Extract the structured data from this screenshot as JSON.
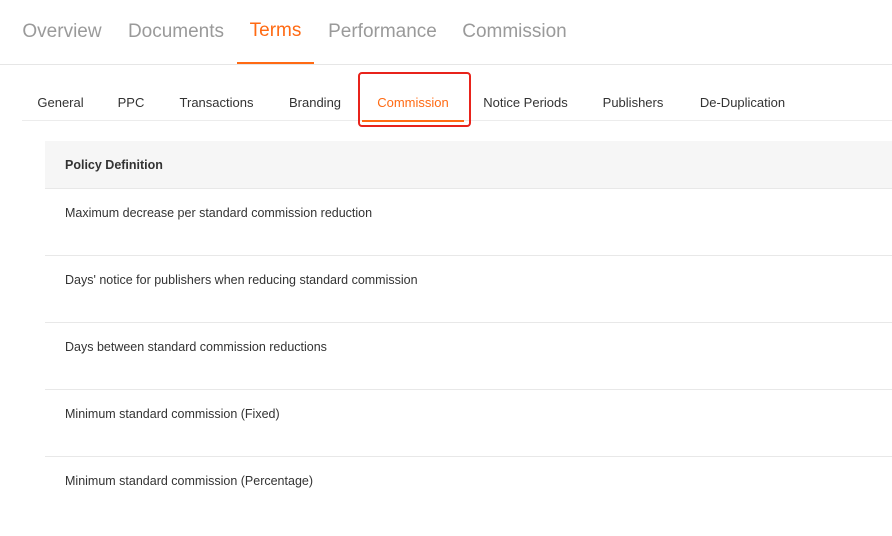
{
  "primary_tabs": [
    {
      "label": "Overview"
    },
    {
      "label": "Documents"
    },
    {
      "label": "Terms"
    },
    {
      "label": "Performance"
    },
    {
      "label": "Commission"
    }
  ],
  "primary_active": "Terms",
  "secondary_tabs": [
    {
      "label": "General"
    },
    {
      "label": "PPC"
    },
    {
      "label": "Transactions"
    },
    {
      "label": "Branding"
    },
    {
      "label": "Commission"
    },
    {
      "label": "Notice Periods"
    },
    {
      "label": "Publishers"
    },
    {
      "label": "De-Duplication"
    }
  ],
  "secondary_active": "Commission",
  "policy": {
    "header": "Policy Definition",
    "rows": [
      {
        "label": "Maximum decrease per standard commission reduction"
      },
      {
        "label": "Days' notice for publishers when reducing standard commission"
      },
      {
        "label": "Days between standard commission reductions"
      },
      {
        "label": "Minimum standard commission (Fixed)"
      },
      {
        "label": "Minimum standard commission (Percentage)"
      }
    ]
  },
  "colors": {
    "accent": "#ff6a13",
    "highlight": "#e8231b",
    "inactive_tab": "#9a9a9a"
  }
}
